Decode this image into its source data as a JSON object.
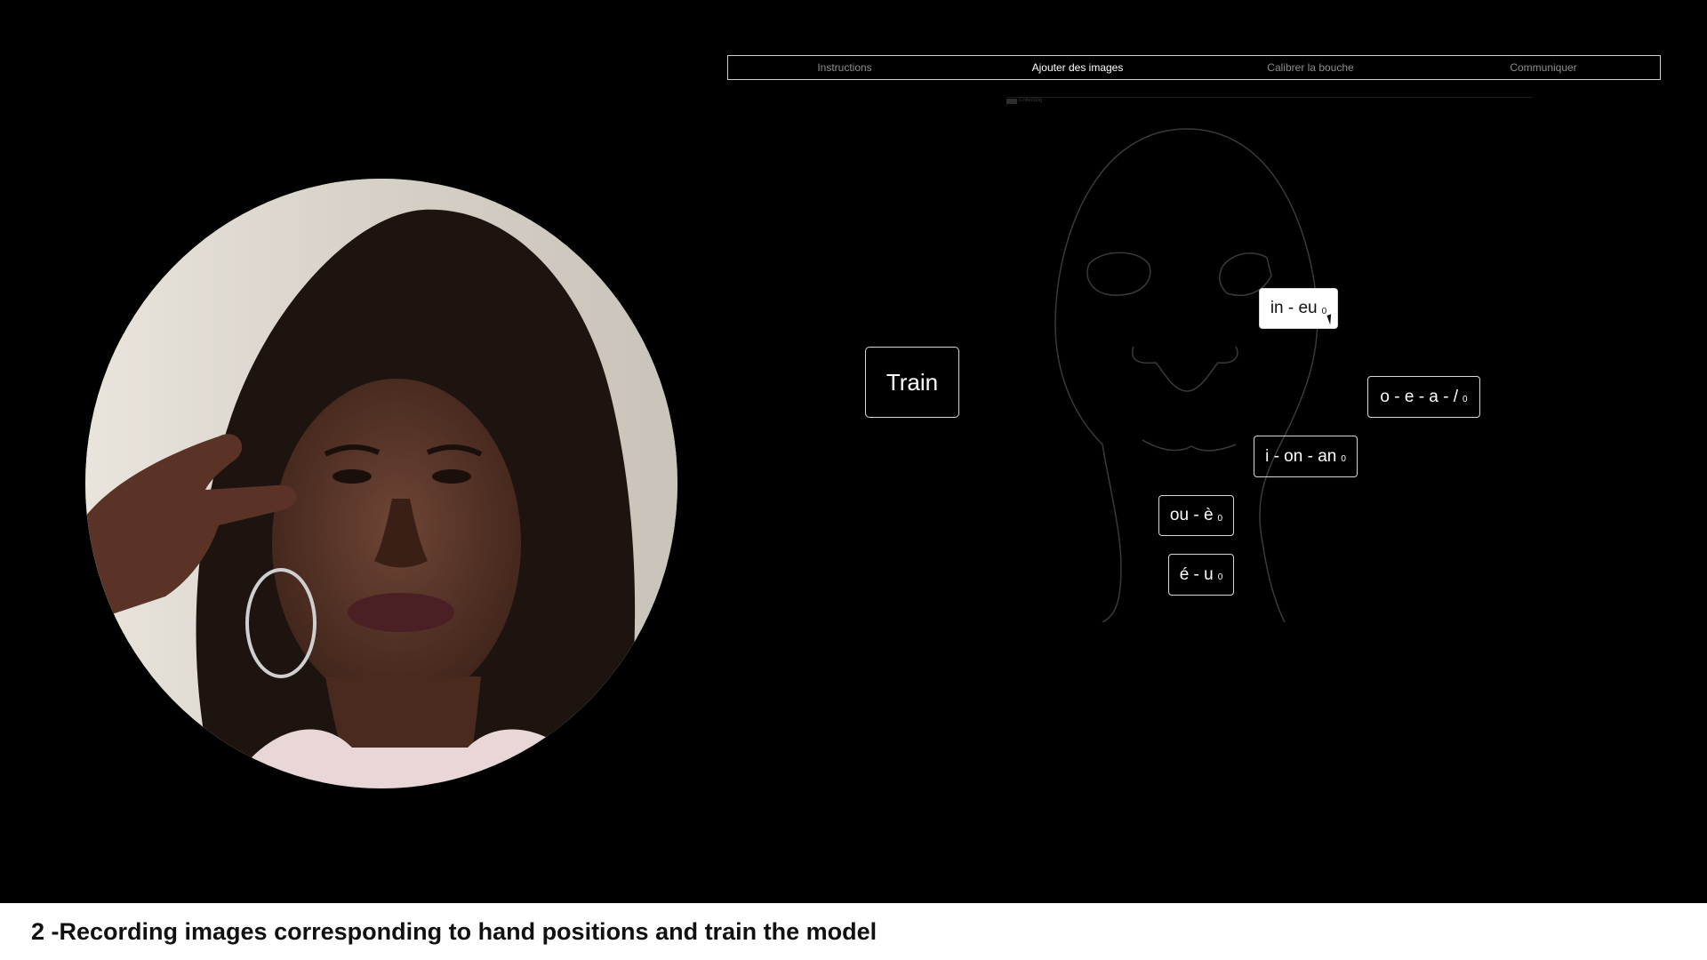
{
  "nav": {
    "tabs": [
      {
        "label": "Instructions",
        "active": false
      },
      {
        "label": "Ajouter des images",
        "active": true
      },
      {
        "label": "Calibrer la bouche",
        "active": false
      },
      {
        "label": "Communiquer",
        "active": false
      }
    ]
  },
  "progress": {
    "label": "Collecting",
    "fraction": 0.02
  },
  "train_button": {
    "label": "Train"
  },
  "keys": [
    {
      "id": "in-eu",
      "label": "in - eu",
      "count": "0",
      "active": true
    },
    {
      "id": "o-e-a",
      "label": "o - e - a - /",
      "count": "0",
      "active": false
    },
    {
      "id": "i-on-an",
      "label": "i - on - an",
      "count": "0",
      "active": false
    },
    {
      "id": "ou-e",
      "label": "ou - è",
      "count": "0",
      "active": false
    },
    {
      "id": "e-u",
      "label": "é - u",
      "count": "0",
      "active": false
    }
  ],
  "caption": "2 -Recording images corresponding to hand positions and train the model",
  "colors": {
    "background": "#000000",
    "accent": "#ffffff",
    "caption_band": "#ffffff"
  }
}
